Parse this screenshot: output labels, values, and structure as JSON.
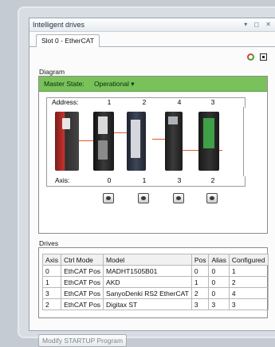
{
  "window": {
    "title": "Intelligent drives",
    "controls": "▾ ◻ ✕"
  },
  "tab": {
    "label": "Slot 0 - EtherCAT"
  },
  "diagram": {
    "group_label": "Diagram",
    "master_state_label": "Master State:",
    "master_state_value": "Operational",
    "address_label": "Address:",
    "addresses": [
      "1",
      "2",
      "4",
      "3"
    ],
    "axis_label": "Axis:",
    "axes": [
      "0",
      "1",
      "3",
      "2"
    ],
    "drive_colors": [
      "#c8332e",
      "#2d2d2d",
      "#2a2f3a",
      "#3fa047"
    ]
  },
  "drives": {
    "group_label": "Drives",
    "columns": [
      "Axis",
      "Ctrl Mode",
      "Model",
      "Pos",
      "Alias",
      "Configured"
    ],
    "rows": [
      [
        "0",
        "EthCAT Pos",
        "MADHT1505B01",
        "0",
        "0",
        "1"
      ],
      [
        "1",
        "EthCAT Pos",
        "AKD",
        "1",
        "0",
        "2"
      ],
      [
        "3",
        "EthCAT Pos",
        "SanyoDenki RS2 EtherCAT",
        "2",
        "0",
        "4"
      ],
      [
        "2",
        "EthCAT Pos",
        "Digitax ST",
        "3",
        "3",
        "3"
      ]
    ]
  },
  "footer": {
    "modify_button": "Modify STARTUP Program"
  },
  "icons": [
    "refresh-icon",
    "dock-icon",
    "dropdown-arrow-icon",
    "io-knob-icon"
  ]
}
